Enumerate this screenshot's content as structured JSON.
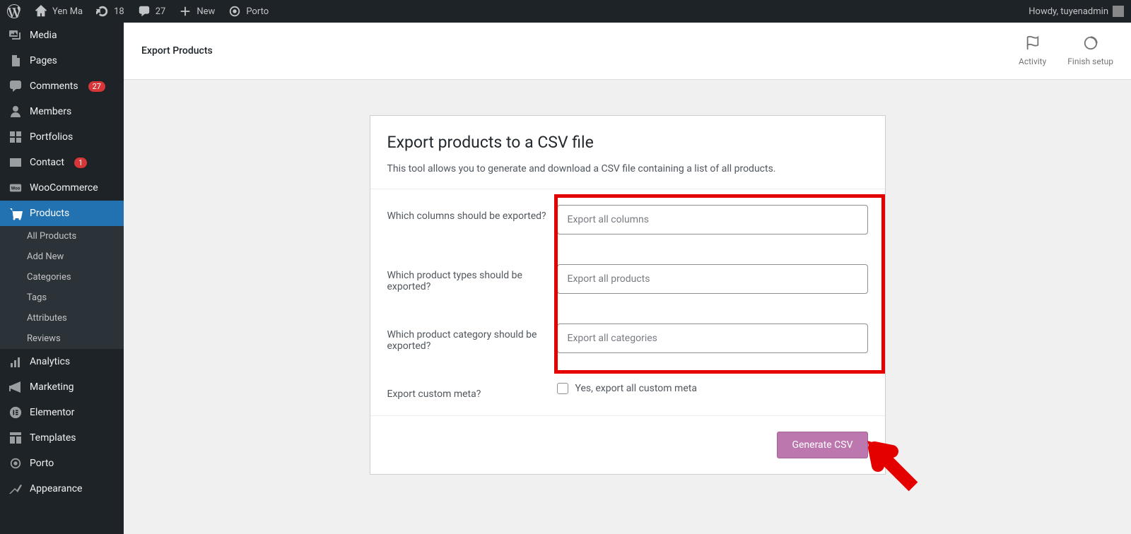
{
  "adminbar": {
    "site_name": "Yen Ma",
    "updates_count": "18",
    "comments_count": "27",
    "new_label": "New",
    "porto_label": "Porto",
    "greeting": "Howdy, tuyenadmin"
  },
  "sidebar": {
    "items": [
      {
        "label": "Media",
        "icon": "media"
      },
      {
        "label": "Pages",
        "icon": "pages"
      },
      {
        "label": "Comments",
        "icon": "comments",
        "badge": "27"
      },
      {
        "label": "Members",
        "icon": "members"
      },
      {
        "label": "Portfolios",
        "icon": "portfolio"
      },
      {
        "label": "Contact",
        "icon": "contact",
        "badge": "1"
      },
      {
        "label": "WooCommerce",
        "icon": "woo"
      },
      {
        "label": "Products",
        "icon": "products",
        "active": true
      },
      {
        "label": "Analytics",
        "icon": "analytics"
      },
      {
        "label": "Marketing",
        "icon": "marketing"
      },
      {
        "label": "Elementor",
        "icon": "elementor"
      },
      {
        "label": "Templates",
        "icon": "templates"
      },
      {
        "label": "Porto",
        "icon": "porto"
      },
      {
        "label": "Appearance",
        "icon": "appearance"
      }
    ],
    "submenu": [
      {
        "label": "All Products"
      },
      {
        "label": "Add New"
      },
      {
        "label": "Categories"
      },
      {
        "label": "Tags"
      },
      {
        "label": "Attributes"
      },
      {
        "label": "Reviews"
      }
    ]
  },
  "header": {
    "title": "Export Products",
    "activity": "Activity",
    "finish_setup": "Finish setup"
  },
  "panel": {
    "title": "Export products to a CSV file",
    "description": "This tool allows you to generate and download a CSV file containing a list of all products.",
    "rows": [
      {
        "label": "Which columns should be exported?",
        "value": "Export all columns"
      },
      {
        "label": "Which product types should be exported?",
        "value": "Export all products"
      },
      {
        "label": "Which product category should be exported?",
        "value": "Export all categories"
      }
    ],
    "meta_label": "Export custom meta?",
    "meta_checkbox": "Yes, export all custom meta",
    "button": "Generate CSV"
  }
}
